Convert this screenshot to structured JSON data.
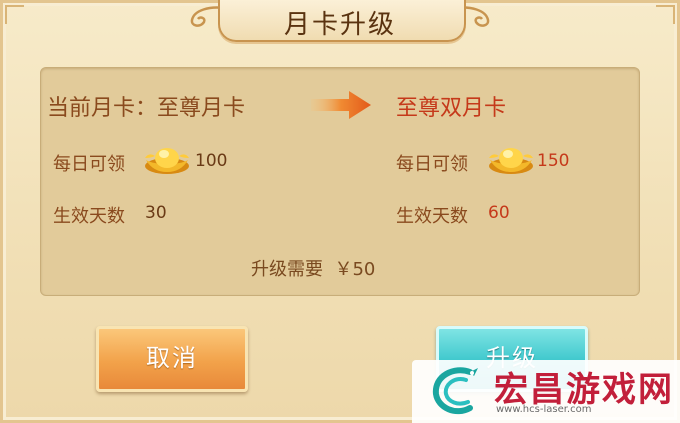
{
  "dialog": {
    "title": "月卡升级"
  },
  "current_card": {
    "label": "当前月卡：至尊月卡",
    "daily_label": "每日可领",
    "daily_value": "100",
    "days_label": "生效天数",
    "days_value": "30"
  },
  "new_card": {
    "label": "至尊双月卡",
    "daily_label": "每日可领",
    "daily_value": "150",
    "days_label": "生效天数",
    "days_value": "60"
  },
  "cost": {
    "text": "升级需要  ￥50"
  },
  "buttons": {
    "cancel": "取消",
    "upgrade": "升级"
  },
  "watermark": {
    "name": "宏昌游戏网",
    "url": "www.hcs-laser.com"
  },
  "icons": {
    "ingot": "gold-ingot-icon",
    "arrow": "right-arrow-icon"
  },
  "colors": {
    "accent_red": "#c5391a",
    "label_brown": "#8a4a1e",
    "cancel_orange": "#f2a24a",
    "upgrade_teal": "#3dc7cc",
    "watermark_red": "#c21f3a"
  }
}
